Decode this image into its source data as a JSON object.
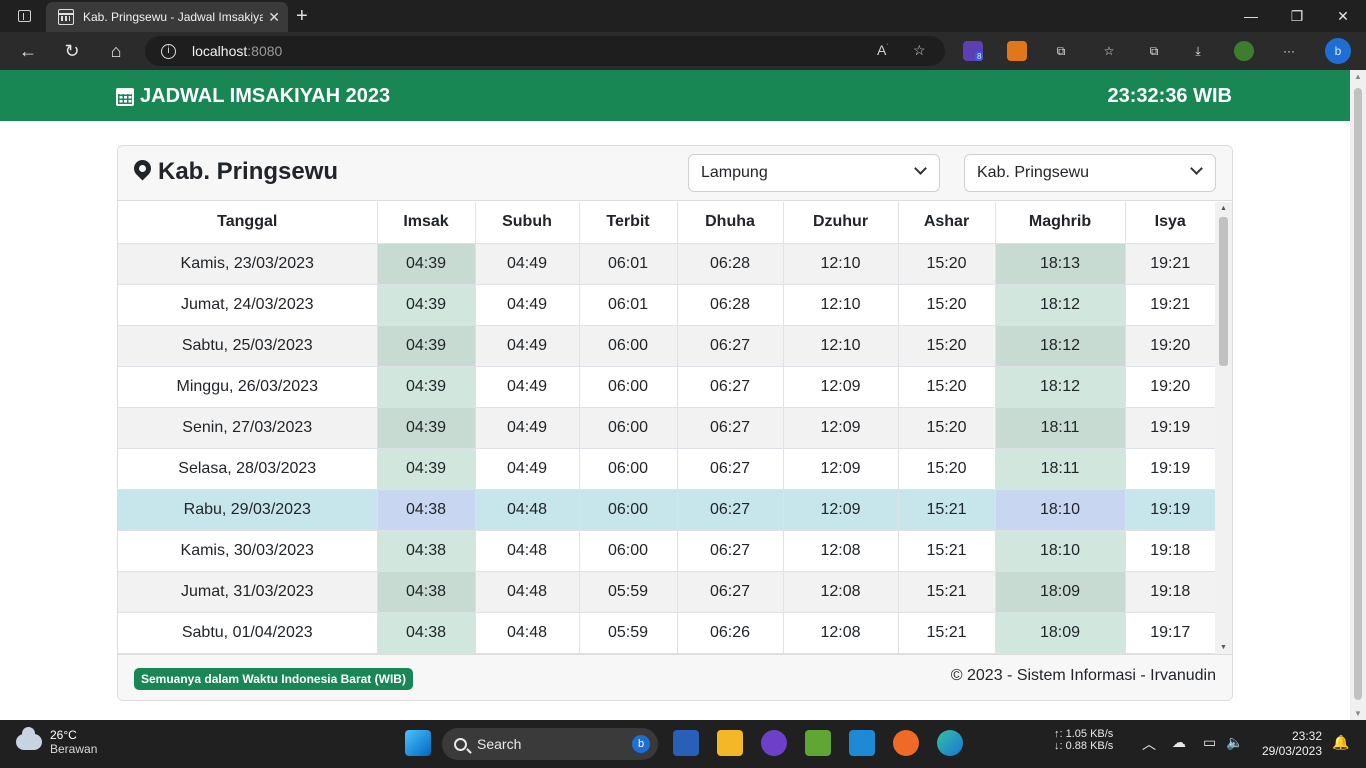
{
  "browser": {
    "tab_title": "Kab. Pringsewu - Jadwal Imsakiyah",
    "url_host": "localhost",
    "url_port": ":8080",
    "extension_badge": "8"
  },
  "header": {
    "app_title": "JADWAL IMSAKIYAH 2023",
    "clock": "23:32:36 WIB"
  },
  "location": {
    "title": "Kab. Pringsewu",
    "province_select": "Lampung",
    "city_select": "Kab. Pringsewu"
  },
  "table": {
    "columns": [
      "Tanggal",
      "Imsak",
      "Subuh",
      "Terbit",
      "Dhuha",
      "Dzuhur",
      "Ashar",
      "Maghrib",
      "Isya"
    ],
    "rows": [
      [
        "Kamis, 23/03/2023",
        "04:39",
        "04:49",
        "06:01",
        "06:28",
        "12:10",
        "15:20",
        "18:13",
        "19:21"
      ],
      [
        "Jumat, 24/03/2023",
        "04:39",
        "04:49",
        "06:01",
        "06:28",
        "12:10",
        "15:20",
        "18:12",
        "19:21"
      ],
      [
        "Sabtu, 25/03/2023",
        "04:39",
        "04:49",
        "06:00",
        "06:27",
        "12:10",
        "15:20",
        "18:12",
        "19:20"
      ],
      [
        "Minggu, 26/03/2023",
        "04:39",
        "04:49",
        "06:00",
        "06:27",
        "12:09",
        "15:20",
        "18:12",
        "19:20"
      ],
      [
        "Senin, 27/03/2023",
        "04:39",
        "04:49",
        "06:00",
        "06:27",
        "12:09",
        "15:20",
        "18:11",
        "19:19"
      ],
      [
        "Selasa, 28/03/2023",
        "04:39",
        "04:49",
        "06:00",
        "06:27",
        "12:09",
        "15:20",
        "18:11",
        "19:19"
      ],
      [
        "Rabu, 29/03/2023",
        "04:38",
        "04:48",
        "06:00",
        "06:27",
        "12:09",
        "15:21",
        "18:10",
        "19:19"
      ],
      [
        "Kamis, 30/03/2023",
        "04:38",
        "04:48",
        "06:00",
        "06:27",
        "12:08",
        "15:21",
        "18:10",
        "19:18"
      ],
      [
        "Jumat, 31/03/2023",
        "04:38",
        "04:48",
        "05:59",
        "06:27",
        "12:08",
        "15:21",
        "18:09",
        "19:18"
      ],
      [
        "Sabtu, 01/04/2023",
        "04:38",
        "04:48",
        "05:59",
        "06:26",
        "12:08",
        "15:21",
        "18:09",
        "19:17"
      ]
    ],
    "today_row_index": 6
  },
  "footer": {
    "badge": "Semuanya dalam Waktu Indonesia Barat (WIB)",
    "copyright": "© 2023 - Sistem Informasi - Irvanudin"
  },
  "taskbar": {
    "weather_temp": "26°C",
    "weather_desc": "Berawan",
    "search_label": "Search",
    "net_up": "↑: 1.05 KB/s",
    "net_down": "↓: 0.88 KB/s",
    "time": "23:32",
    "date": "29/03/2023"
  },
  "colors": {
    "brand_green": "#198754",
    "highlight_column": "#d1e7dd",
    "today_row": "#c7e6ec"
  }
}
